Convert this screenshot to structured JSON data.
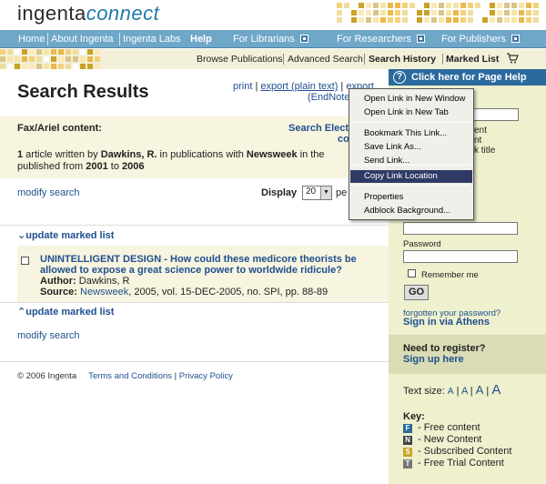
{
  "header": {
    "logo_main": "ingenta",
    "logo_sub": "connect"
  },
  "navbar": {
    "home": "Home",
    "about": "About Ingenta",
    "labs": "Ingenta Labs",
    "help": "Help",
    "librarians": "For Librarians",
    "researchers": "For Researchers",
    "publishers": "For Publishers"
  },
  "subnav": {
    "browse": "Browse Publications",
    "advanced": "Advanced Search",
    "history": "Search History",
    "marked": "Marked List"
  },
  "main": {
    "title": "Search Results",
    "print": "print",
    "export_plain": "export (plain text)",
    "export2": "export",
    "endnote": "(EndNote",
    "fax_label": "Fax/Ariel content:",
    "search_elec": "Search Elect",
    "search_elec2": "co",
    "summary": {
      "count": "1",
      "part1": " article written by ",
      "author": "Dawkins, R.",
      "part2": " in publications with ",
      "publication": "Newsweek",
      "part3": " in the",
      "part4": "published from ",
      "year_from": "2001",
      "part5": " to ",
      "year_to": "2006"
    },
    "modify_search": "modify search",
    "display_label": "Display",
    "display_value": "20",
    "per_page": "pe",
    "update_marked": "update marked list",
    "result": {
      "title": "UNINTELLIGENT DESIGN - How could these medicore theorists be allowed to expose a great science power to worldwide ridicule?",
      "author_label": "Author:",
      "author": "Dawkins, R",
      "source_label": "Source:",
      "source_link": "Newsweek",
      "source_rest": ", 2005, vol. 15-DEC-2005, no. SPI, pp. 88-89"
    },
    "footer": {
      "copyright": "© 2006 Ingenta",
      "terms": "Terms and Conditions",
      "privacy": "Privacy Policy"
    }
  },
  "sidebar": {
    "help_button": "Click here for Page Help",
    "frag_ent": "ent",
    "frag_nt": "nt",
    "frag_title": "k title",
    "password_label": "Password",
    "remember_me": "Remember me",
    "go": "GO",
    "forgot": "forgotten your password?",
    "athens": "Sign in via Athens",
    "register_q": "Need to register?",
    "signup": "Sign up here",
    "textsize_label": "Text size:",
    "textsize_options": [
      "A",
      "A",
      "A",
      "A"
    ],
    "key_title": "Key:",
    "key_items": [
      {
        "letter": "F",
        "label": " - Free content",
        "color": "#2b6a9d"
      },
      {
        "letter": "N",
        "label": " - New Content",
        "color": "#444444"
      },
      {
        "letter": "S",
        "label": " - Subscribed Content",
        "color": "#c9a227"
      },
      {
        "letter": "T",
        "label": " - Free Trial Content",
        "color": "#777777"
      }
    ]
  },
  "context_menu": {
    "items": [
      "Open Link in New Window",
      "Open Link in New Tab",
      "Bookmark This Link...",
      "Save Link As...",
      "Send Link...",
      "Copy Link Location",
      "Properties",
      "Adblock Background..."
    ],
    "selected": "Copy Link Location"
  },
  "colors": {
    "nav_blue": "#6fa7c9",
    "link": "#1f4f8f",
    "sidebar_bg": "#eef0ce",
    "cream": "#f7f4df",
    "menu_highlight": "#2f3b66"
  }
}
